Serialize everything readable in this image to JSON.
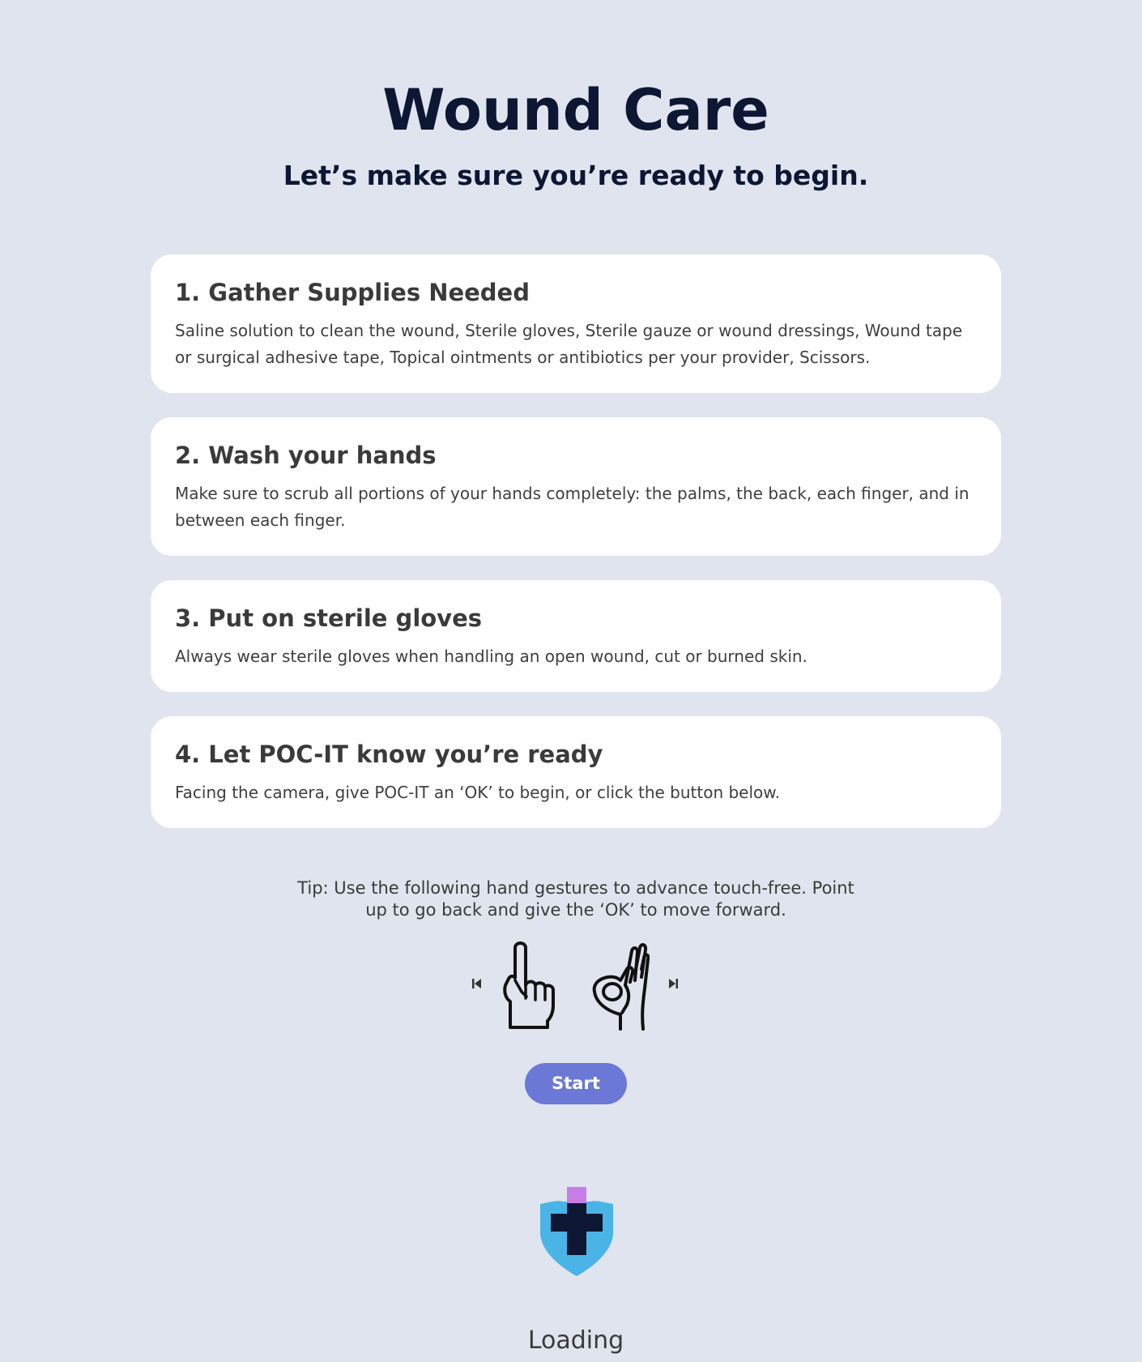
{
  "header": {
    "title": "Wound Care",
    "subtitle": "Let’s make sure you’re ready to begin."
  },
  "steps": [
    {
      "title": "1. Gather Supplies Needed",
      "body": "Saline solution to clean the wound, Sterile gloves, Sterile gauze or wound dressings, Wound tape or surgical adhesive tape, Topical ointments or antibiotics per your provider, Scissors."
    },
    {
      "title": "2. Wash your hands",
      "body": "Make sure to scrub all portions of your hands completely: the palms, the back, each finger, and in between each finger."
    },
    {
      "title": "3. Put on sterile gloves",
      "body": "Always wear sterile gloves when handling an open wound, cut or burned skin."
    },
    {
      "title": "4. Let POC-IT know you’re ready",
      "body": "Facing the camera, give POC-IT an ‘OK’ to begin, or click the button below."
    }
  ],
  "tip": {
    "text": "Tip: Use the following hand gestures to advance touch-free. Point up to go back and give the ‘OK’ to move forward."
  },
  "gestures": {
    "back_icon": "skip-back-icon",
    "point_icon": "point-up-hand-icon",
    "ok_icon": "ok-hand-icon",
    "forward_icon": "skip-forward-icon"
  },
  "actions": {
    "start_label": "Start"
  },
  "footer": {
    "logo_icon": "medical-shield-cross-icon",
    "loading_text": "Loading"
  },
  "colors": {
    "background": "#dfe4ee",
    "title": "#0d1633",
    "card": "#ffffff",
    "button": "#6b78d6",
    "logo_shield": "#4bb4e6",
    "logo_cross": "#0d1633",
    "logo_accent": "#c57ee6"
  }
}
